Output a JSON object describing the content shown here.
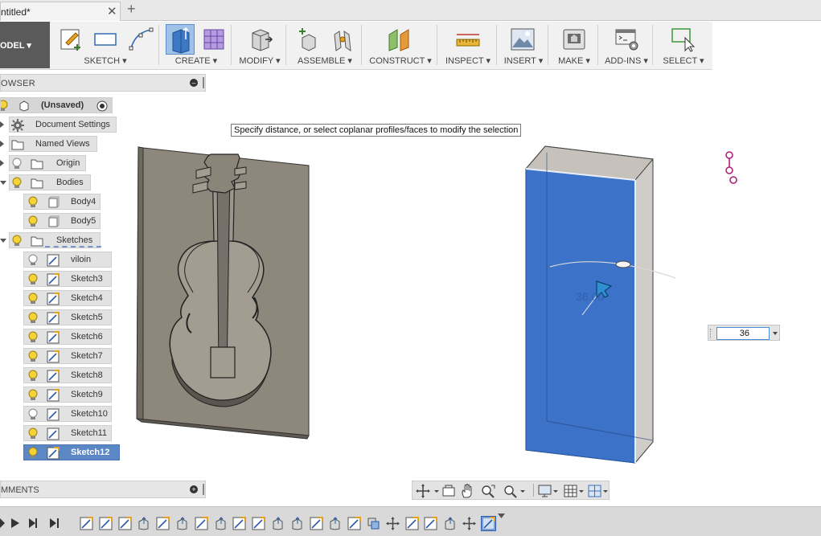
{
  "tab": {
    "title": "ntitled*",
    "close": "✕",
    "new_tab": "+"
  },
  "ribbon": {
    "workspace": "ODEL ▾",
    "groups": [
      {
        "id": "sketch",
        "label": "SKETCH ▾"
      },
      {
        "id": "create",
        "label": "CREATE ▾"
      },
      {
        "id": "modify",
        "label": "MODIFY ▾"
      },
      {
        "id": "assemble",
        "label": "ASSEMBLE ▾"
      },
      {
        "id": "construct",
        "label": "CONSTRUCT ▾"
      },
      {
        "id": "inspect",
        "label": "INSPECT ▾"
      },
      {
        "id": "insert",
        "label": "INSERT ▾"
      },
      {
        "id": "make",
        "label": "MAKE ▾"
      },
      {
        "id": "addins",
        "label": "ADD-INS ▾"
      },
      {
        "id": "select",
        "label": "SELECT ▾"
      }
    ]
  },
  "browser": {
    "title": "OWSER",
    "root": "(Unsaved)",
    "items": [
      {
        "label": "Document Settings",
        "icon": "gear-icon"
      },
      {
        "label": "Named Views",
        "icon": "folder-icon"
      },
      {
        "label": "Origin",
        "icon": "folder-icon"
      },
      {
        "label": "Bodies",
        "icon": "folder-icon"
      },
      {
        "label": "Body4",
        "icon": "body-icon"
      },
      {
        "label": "Body5",
        "icon": "body-icon"
      },
      {
        "label": "Sketches",
        "icon": "folder-icon"
      },
      {
        "label": "viloin",
        "icon": "sketch-icon"
      },
      {
        "label": "Sketch3",
        "icon": "sketch-icon"
      },
      {
        "label": "Sketch4",
        "icon": "sketch-icon"
      },
      {
        "label": "Sketch5",
        "icon": "sketch-icon"
      },
      {
        "label": "Sketch6",
        "icon": "sketch-icon"
      },
      {
        "label": "Sketch7",
        "icon": "sketch-icon"
      },
      {
        "label": "Sketch8",
        "icon": "sketch-icon"
      },
      {
        "label": "Sketch9",
        "icon": "sketch-icon"
      },
      {
        "label": "Sketch10",
        "icon": "sketch-icon"
      },
      {
        "label": "Sketch11",
        "icon": "sketch-icon"
      },
      {
        "label": "Sketch12",
        "icon": "sketch-icon"
      }
    ]
  },
  "comments": {
    "title": "MMENTS"
  },
  "tooltip": "Specify distance, or select coplanar profiles/faces to modify the selection",
  "canvas": {
    "dimension_label": "36.00"
  },
  "dimension_input": {
    "value": "36"
  },
  "colors": {
    "selection_blue": "#3c73c8",
    "body_gray": "#8a8478",
    "accent_magenta": "#b0207a"
  }
}
